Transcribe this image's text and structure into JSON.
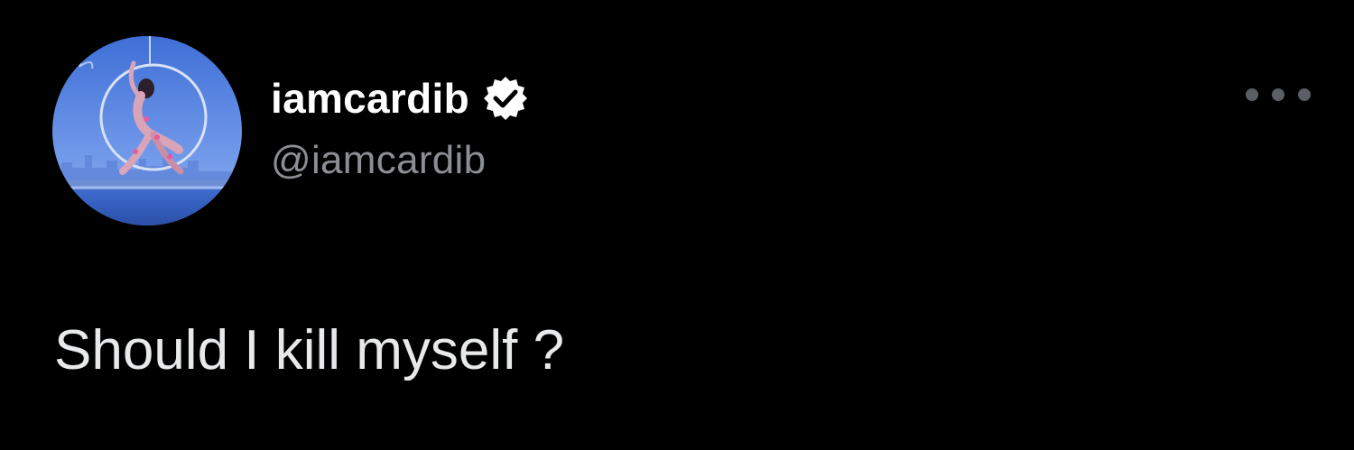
{
  "tweet": {
    "display_name": "iamcardib",
    "handle": "@iamcardib",
    "verified": true,
    "text": "Should I kill myself ?"
  },
  "icons": {
    "verified": "verified-badge-icon",
    "more": "more-options-icon"
  },
  "colors": {
    "background": "#000000",
    "display_name": "#ffffff",
    "handle": "#8b8f94",
    "body_text": "#e7e9ea",
    "more_dots": "#5b5f64"
  }
}
